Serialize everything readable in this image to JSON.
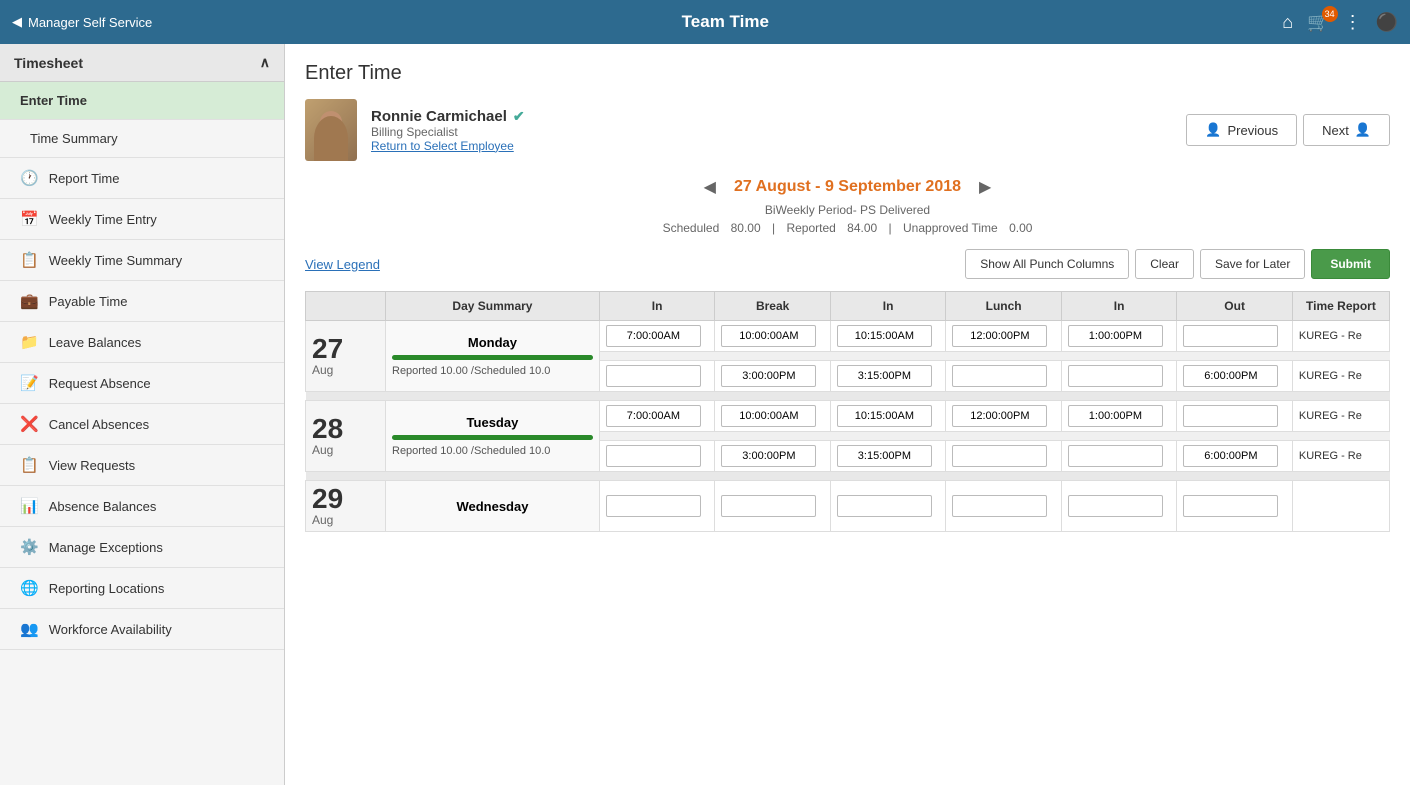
{
  "topNav": {
    "back_label": "Manager Self Service",
    "title": "Team Time",
    "cart_badge": "34"
  },
  "sidebar": {
    "header": "Timesheet",
    "items": [
      {
        "id": "enter-time",
        "label": "Enter Time",
        "active": true,
        "icon": ""
      },
      {
        "id": "time-summary",
        "label": "Time Summary",
        "active": false,
        "icon": ""
      },
      {
        "id": "report-time",
        "label": "Report Time",
        "active": false,
        "icon": "🕐"
      },
      {
        "id": "weekly-time-entry",
        "label": "Weekly Time Entry",
        "active": false,
        "icon": "📅"
      },
      {
        "id": "weekly-time-summary",
        "label": "Weekly Time Summary",
        "active": false,
        "icon": "📋"
      },
      {
        "id": "payable-time",
        "label": "Payable Time",
        "active": false,
        "icon": "💼"
      },
      {
        "id": "leave-balances",
        "label": "Leave Balances",
        "active": false,
        "icon": "📁"
      },
      {
        "id": "request-absence",
        "label": "Request Absence",
        "active": false,
        "icon": "📝"
      },
      {
        "id": "cancel-absences",
        "label": "Cancel Absences",
        "active": false,
        "icon": "❌"
      },
      {
        "id": "view-requests",
        "label": "View Requests",
        "active": false,
        "icon": "📋"
      },
      {
        "id": "absence-balances",
        "label": "Absence Balances",
        "active": false,
        "icon": "📊"
      },
      {
        "id": "manage-exceptions",
        "label": "Manage Exceptions",
        "active": false,
        "icon": "⚙️"
      },
      {
        "id": "reporting-locations",
        "label": "Reporting Locations",
        "active": false,
        "icon": "🌐"
      },
      {
        "id": "workforce-availability",
        "label": "Workforce Availability",
        "active": false,
        "icon": "👥"
      }
    ]
  },
  "page": {
    "title": "Enter Time",
    "employee_name": "Ronnie Carmichael",
    "employee_title": "Billing Specialist",
    "return_link": "Return to Select Employee",
    "prev_label": "Previous",
    "next_label": "Next",
    "date_range": "27 August - 9 September 2018",
    "period_type": "BiWeekly Period- PS Delivered",
    "scheduled": "80.00",
    "reported": "84.00",
    "unapproved": "0.00",
    "view_legend": "View Legend",
    "btn_show_all": "Show All Punch Columns",
    "btn_clear": "Clear",
    "btn_save": "Save for Later",
    "btn_submit": "Submit"
  },
  "table": {
    "headers": [
      "Day Summary",
      "In",
      "Break",
      "In",
      "Lunch",
      "In",
      "Out",
      "Time Report"
    ],
    "rows": [
      {
        "day_num": "27",
        "day_month": "Aug",
        "day_name": "Monday",
        "progress": 100,
        "reported": "10.00",
        "scheduled": "10.0",
        "entries": [
          {
            "in": "7:00:00AM",
            "break": "10:00:00AM",
            "in2": "10:15:00AM",
            "lunch": "12:00:00PM",
            "in3": "1:00:00PM",
            "out": "",
            "code": "KUREG - Re"
          },
          {
            "in": "",
            "break": "3:00:00PM",
            "in2": "3:15:00PM",
            "lunch": "",
            "in3": "",
            "out": "6:00:00PM",
            "code": "KUREG - Re"
          }
        ]
      },
      {
        "day_num": "28",
        "day_month": "Aug",
        "day_name": "Tuesday",
        "progress": 100,
        "reported": "10.00",
        "scheduled": "10.0",
        "entries": [
          {
            "in": "7:00:00AM",
            "break": "10:00:00AM",
            "in2": "10:15:00AM",
            "lunch": "12:00:00PM",
            "in3": "1:00:00PM",
            "out": "",
            "code": "KUREG - Re"
          },
          {
            "in": "",
            "break": "3:00:00PM",
            "in2": "3:15:00PM",
            "lunch": "",
            "in3": "",
            "out": "6:00:00PM",
            "code": "KUREG - Re"
          }
        ]
      },
      {
        "day_num": "29",
        "day_month": "Aug",
        "day_name": "Wednesday",
        "progress": 0,
        "reported": "",
        "scheduled": "",
        "entries": []
      }
    ]
  }
}
